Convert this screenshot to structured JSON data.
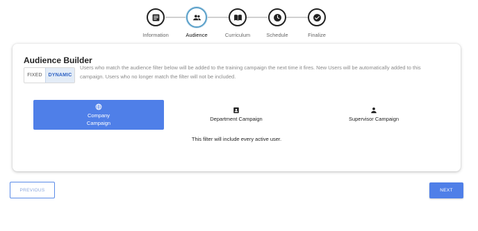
{
  "stepper": {
    "steps": [
      {
        "label": "Information",
        "icon": "information-icon",
        "active": false
      },
      {
        "label": "Audience",
        "icon": "users-icon",
        "active": true
      },
      {
        "label": "Curriculum",
        "icon": "book-icon",
        "active": false
      },
      {
        "label": "Schedule",
        "icon": "clock-icon",
        "active": false
      },
      {
        "label": "Finalize",
        "icon": "check-circle-icon",
        "active": false
      }
    ]
  },
  "builder": {
    "title": "Audience Builder",
    "toggle": {
      "fixed_label": "FIXED",
      "dynamic_label": "DYNAMIC",
      "selected": "DYNAMIC"
    },
    "description": "Users who match the audience filter below will be added to the training campaign the next time it fires. New Users will be automatically added to this campaign. Users who no longer match the filter will not be included.",
    "options": [
      {
        "label": "Company Campaign",
        "icon": "globe-icon",
        "selected": true
      },
      {
        "label": "Department Campaign",
        "icon": "contact-card-icon",
        "selected": false
      },
      {
        "label": "Supervisor Campaign",
        "icon": "person-icon",
        "selected": false
      }
    ],
    "filter_note": "This filter will include every active user."
  },
  "footer": {
    "previous_label": "PREVIOUS",
    "next_label": "NEXT"
  },
  "colors": {
    "accent": "#4f7fe8",
    "active_ring": "#5aa0c9",
    "toggle_selected_bg": "#e3ecf7"
  }
}
